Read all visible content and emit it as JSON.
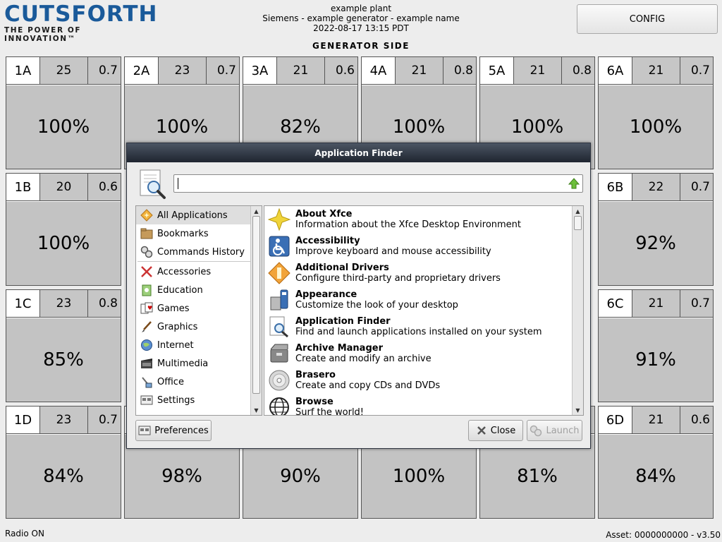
{
  "header": {
    "logo_main": "CUTSFORTH",
    "logo_sub": "THE POWER OF INNOVATION™",
    "plant": "example plant",
    "generator": "Siemens - example generator - example name",
    "timestamp": "2022-08-17 13:15 PDT",
    "config_label": "CONFIG",
    "section_title": "GENERATOR SIDE"
  },
  "tiles": [
    {
      "id": "1A",
      "value": "25",
      "ratio": "0.7",
      "pct": "100%"
    },
    {
      "id": "2A",
      "value": "23",
      "ratio": "0.7",
      "pct": "100%"
    },
    {
      "id": "3A",
      "value": "21",
      "ratio": "0.6",
      "pct": "82%"
    },
    {
      "id": "4A",
      "value": "21",
      "ratio": "0.8",
      "pct": "100%"
    },
    {
      "id": "5A",
      "value": "21",
      "ratio": "0.8",
      "pct": "100%"
    },
    {
      "id": "6A",
      "value": "21",
      "ratio": "0.7",
      "pct": "100%"
    },
    {
      "id": "1B",
      "value": "20",
      "ratio": "0.6",
      "pct": "100%"
    },
    {
      "id": "6B",
      "value": "22",
      "ratio": "0.7",
      "pct": "92%"
    },
    {
      "id": "1C",
      "value": "23",
      "ratio": "0.8",
      "pct": "85%"
    },
    {
      "id": "6C",
      "value": "21",
      "ratio": "0.7",
      "pct": "91%"
    },
    {
      "id": "1D",
      "value": "23",
      "ratio": "0.7",
      "pct": "84%"
    },
    {
      "id": "",
      "value": "",
      "ratio": "",
      "pct": "98%"
    },
    {
      "id": "",
      "value": "",
      "ratio": "",
      "pct": "90%"
    },
    {
      "id": "",
      "value": "",
      "ratio": "",
      "pct": "100%"
    },
    {
      "id": "",
      "value": "",
      "ratio": "",
      "pct": "81%"
    },
    {
      "id": "6D",
      "value": "21",
      "ratio": "0.6",
      "pct": "84%"
    }
  ],
  "footer": {
    "radio": "Radio ON",
    "asset": "Asset: 0000000000 - v3.50"
  },
  "dialog": {
    "title": "Application Finder",
    "search_value": "",
    "categories": [
      {
        "label": "All Applications",
        "icon": "star-diamond-icon"
      },
      {
        "label": "Bookmarks",
        "icon": "bookmarks-icon"
      },
      {
        "label": "Commands History",
        "icon": "commands-history-icon"
      },
      {
        "label": "Accessories",
        "icon": "accessories-icon"
      },
      {
        "label": "Education",
        "icon": "education-icon"
      },
      {
        "label": "Games",
        "icon": "games-icon"
      },
      {
        "label": "Graphics",
        "icon": "graphics-icon"
      },
      {
        "label": "Internet",
        "icon": "internet-icon"
      },
      {
        "label": "Multimedia",
        "icon": "multimedia-icon"
      },
      {
        "label": "Office",
        "icon": "office-icon"
      },
      {
        "label": "Settings",
        "icon": "settings-icon"
      }
    ],
    "apps": [
      {
        "name": "About Xfce",
        "desc": "Information about the Xfce Desktop Environment",
        "icon": "xfce-star-icon"
      },
      {
        "name": "Accessibility",
        "desc": "Improve keyboard and mouse accessibility",
        "icon": "accessibility-icon"
      },
      {
        "name": "Additional Drivers",
        "desc": "Configure third-party and proprietary drivers",
        "icon": "drivers-icon"
      },
      {
        "name": "Appearance",
        "desc": "Customize the look of your desktop",
        "icon": "appearance-icon"
      },
      {
        "name": "Application Finder",
        "desc": "Find and launch applications installed on your system",
        "icon": "app-finder-icon"
      },
      {
        "name": "Archive Manager",
        "desc": "Create and modify an archive",
        "icon": "archive-icon"
      },
      {
        "name": "Brasero",
        "desc": "Create and copy CDs and DVDs",
        "icon": "cd-icon"
      },
      {
        "name": "Browse",
        "desc": "Surf the world!",
        "icon": "globe-icon"
      }
    ],
    "preferences_label": "Preferences",
    "close_label": "Close",
    "launch_label": "Launch"
  }
}
